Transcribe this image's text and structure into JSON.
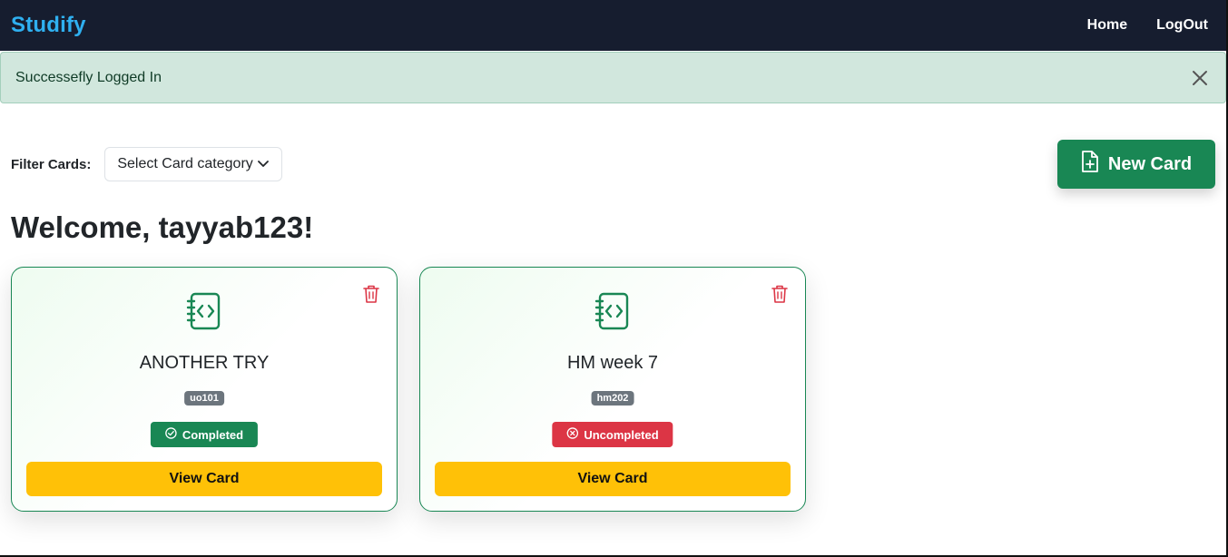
{
  "navbar": {
    "brand": "Studify",
    "links": [
      "Home",
      "LogOut"
    ]
  },
  "alert": {
    "message": "Successefly Logged In"
  },
  "filter": {
    "label": "Filter Cards:",
    "selected": "Select Card category"
  },
  "new_card_button": "New Card",
  "welcome": "Welcome, tayyab123!",
  "cards": [
    {
      "title": "ANOTHER TRY",
      "code": "uo101",
      "status": "Completed",
      "view": "View Card"
    },
    {
      "title": "HM week 7",
      "code": "hm202",
      "status": "Uncompleted",
      "view": "View Card"
    }
  ],
  "colors": {
    "navbar": "#161d2f",
    "brand": "#2fb0f0",
    "success": "#198754",
    "danger": "#dc3545",
    "warning": "#ffc107",
    "alert_bg": "#d1e7dd"
  }
}
